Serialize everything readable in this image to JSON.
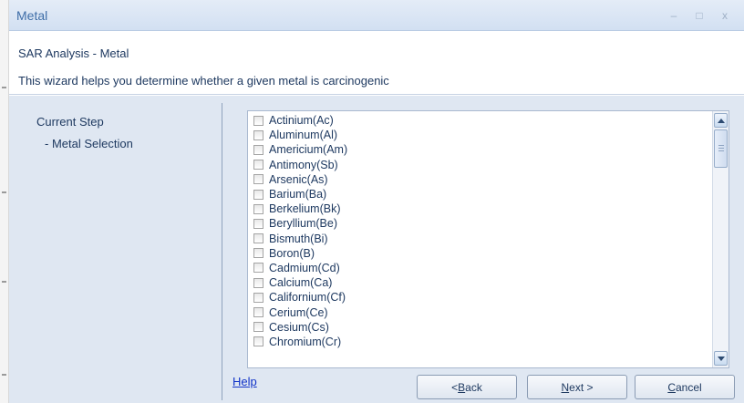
{
  "window": {
    "title": "Metal",
    "controls": {
      "minimize": "–",
      "maximize": "□",
      "close": "x"
    }
  },
  "header": {
    "title": "SAR Analysis - Metal",
    "description": "This wizard helps you determine whether a given metal is carcinogenic"
  },
  "steps": {
    "title": "Current Step",
    "items": [
      "- Metal Selection"
    ]
  },
  "metals": [
    {
      "label": "Actinium(Ac)",
      "checked": false
    },
    {
      "label": "Aluminum(Al)",
      "checked": false
    },
    {
      "label": "Americium(Am)",
      "checked": false
    },
    {
      "label": "Antimony(Sb)",
      "checked": false
    },
    {
      "label": "Arsenic(As)",
      "checked": false
    },
    {
      "label": "Barium(Ba)",
      "checked": false
    },
    {
      "label": "Berkelium(Bk)",
      "checked": false
    },
    {
      "label": "Beryllium(Be)",
      "checked": false
    },
    {
      "label": "Bismuth(Bi)",
      "checked": false
    },
    {
      "label": "Boron(B)",
      "checked": false
    },
    {
      "label": "Cadmium(Cd)",
      "checked": false
    },
    {
      "label": "Calcium(Ca)",
      "checked": false
    },
    {
      "label": "Californium(Cf)",
      "checked": false
    },
    {
      "label": "Cerium(Ce)",
      "checked": false
    },
    {
      "label": "Cesium(Cs)",
      "checked": false
    },
    {
      "label": "Chromium(Cr)",
      "checked": false
    }
  ],
  "footer": {
    "help": "Help",
    "back_prefix": "< ",
    "back_key": "B",
    "back_rest": "ack",
    "next_key": "N",
    "next_rest": "ext >",
    "cancel_key": "C",
    "cancel_rest": "ancel"
  },
  "colors": {
    "title_text": "#3f6ea8",
    "body_text": "#1e3960",
    "panel_bg": "#dfe7f2",
    "link": "#1033c8"
  }
}
